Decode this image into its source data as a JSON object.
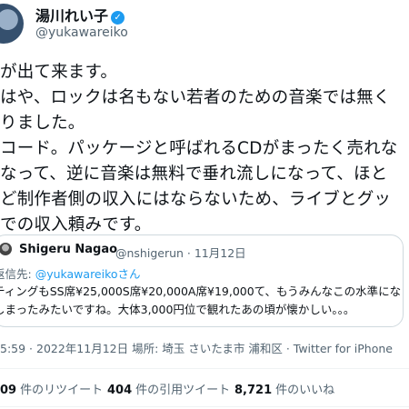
{
  "author": {
    "display_name": "湯川れい子",
    "verified_glyph": "✓",
    "handle": "@yukawareiko"
  },
  "tweet": {
    "lines": [
      "が出て来ます。",
      "はや、ロックは名もない若者のための音楽では無く",
      "りました。",
      "コード。パッケージと呼ばれるCDがまったく売れな",
      "なって、逆に音楽は無料で垂れ流しになって、ほと",
      "ど制作者側の収入にはならないため、ライブとグッ",
      "での収入頼みです。"
    ]
  },
  "quote": {
    "author_name": "Shigeru Nagao",
    "handle_date": "@nshigerun · 11月12日",
    "reply_prefix": "返信先: ",
    "reply_to": "@yukawareikoさん",
    "lines": [
      "ティングもSS席¥25,000S席¥20,000A席¥19,000て、もうみんなこの水準になっ",
      "しまったみたいですね。大体3,000円位で観れたあの頃が懐かしい。。。"
    ]
  },
  "meta_line": "5:59 · 2022年11月12日 場所: 埼玉 さいたま市 浦和区 · Twitter for iPhone",
  "stats": {
    "retweets": {
      "value": "09",
      "label": "件のリツイート"
    },
    "quotes": {
      "value": "404",
      "label": "件の引用ツイート"
    },
    "likes": {
      "value": "8,721",
      "label": "件のいいね"
    }
  },
  "colors": {
    "accent": "#1d9bf0",
    "text": "#0f1419",
    "secondary_text": "#536471",
    "border": "#cfd9de"
  }
}
